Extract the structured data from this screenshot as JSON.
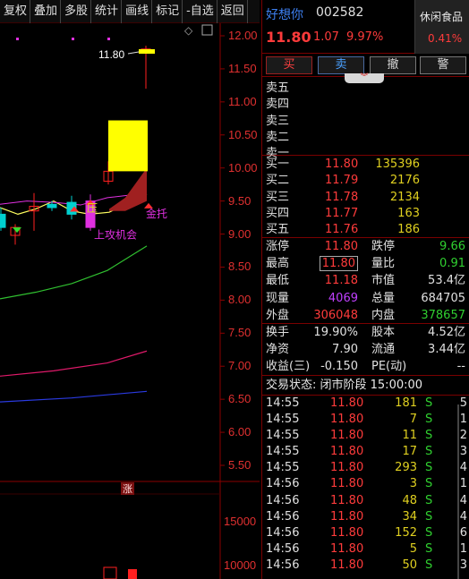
{
  "toolbar": {
    "items": [
      "复权",
      "叠加",
      "多股",
      "统计",
      "画线",
      "标记",
      "-自选",
      "返回"
    ]
  },
  "chart": {
    "price_axis": [
      "12.00",
      "11.50",
      "11.00",
      "10.50",
      "10.00",
      "9.50",
      "9.00",
      "8.50",
      "8.00",
      "7.50",
      "7.00",
      "6.50",
      "6.00",
      "5.50"
    ],
    "volume_axis": [
      "15000",
      "10000"
    ],
    "last_price_label": "11.80",
    "annotations": {
      "pressure": "压",
      "opportunity": "上攻机会",
      "support": "金托",
      "limit_up": "涨"
    },
    "colors": {
      "up": "#ff2020",
      "down": "#00d0d0",
      "limit_block": "#ffff00",
      "ma_fast": "#ffff60",
      "ma_mid": "#30c030",
      "ma_long": "#e01a6a",
      "ma_longest": "#2a3ae0",
      "dot": "#e030e0"
    }
  },
  "stock": {
    "name": "好想你",
    "code": "002582",
    "price": "11.80",
    "change": "1.07",
    "change_pct": "9.97%",
    "sector_name": "休闲食品",
    "sector_pct": "0.41%"
  },
  "trade_buttons": {
    "buy": "买",
    "sell": "卖",
    "cancel": "撤",
    "alert": "警",
    "expand": "︾"
  },
  "sell_book": [
    {
      "label": "卖五",
      "price": "",
      "vol": ""
    },
    {
      "label": "卖四",
      "price": "",
      "vol": ""
    },
    {
      "label": "卖三",
      "price": "",
      "vol": ""
    },
    {
      "label": "卖二",
      "price": "",
      "vol": ""
    },
    {
      "label": "卖一",
      "price": "",
      "vol": ""
    }
  ],
  "buy_book": [
    {
      "label": "买一",
      "price": "11.80",
      "vol": "135396"
    },
    {
      "label": "买二",
      "price": "11.79",
      "vol": "2176"
    },
    {
      "label": "买三",
      "price": "11.78",
      "vol": "2134"
    },
    {
      "label": "买四",
      "price": "11.77",
      "vol": "163"
    },
    {
      "label": "买五",
      "price": "11.76",
      "vol": "186"
    }
  ],
  "stats": [
    {
      "l1": "涨停",
      "v1": "11.80",
      "c1": "#ff3b3b",
      "l2": "跌停",
      "v2": "9.66",
      "c2": "#30d030"
    },
    {
      "l1": "最高",
      "v1": "11.80",
      "c1": "#ff3b3b",
      "l2": "量比",
      "v2": "0.91",
      "c2": "#30d030"
    },
    {
      "l1": "最低",
      "v1": "11.18",
      "c1": "#ff3b3b",
      "l2": "市值",
      "v2": "53.4亿",
      "c2": "#e0e0e0"
    },
    {
      "l1": "现量",
      "v1": "4069",
      "c1": "#c040ff",
      "l2": "总量",
      "v2": "684705",
      "c2": "#e0e0e0"
    },
    {
      "l1": "外盘",
      "v1": "306048",
      "c1": "#ff3b3b",
      "l2": "内盘",
      "v2": "378657",
      "c2": "#30d030"
    }
  ],
  "stats2": [
    {
      "l1": "换手",
      "v1": "19.90%",
      "l2": "股本",
      "v2": "4.52亿"
    },
    {
      "l1": "净资",
      "v1": "7.90",
      "l2": "流通",
      "v2": "3.44亿"
    },
    {
      "l1": "收益(三)",
      "v1": "-0.150",
      "l2": "PE(动)",
      "v2": "--"
    }
  ],
  "phase": {
    "text": "交易状态: 闭市阶段 15:00:00"
  },
  "ticks": [
    {
      "time": "14:55",
      "price": "11.80",
      "vol": "181",
      "dir": "S",
      "n": "5"
    },
    {
      "time": "14:55",
      "price": "11.80",
      "vol": "7",
      "dir": "S",
      "n": "1"
    },
    {
      "time": "14:55",
      "price": "11.80",
      "vol": "11",
      "dir": "S",
      "n": "2"
    },
    {
      "time": "14:55",
      "price": "11.80",
      "vol": "17",
      "dir": "S",
      "n": "3"
    },
    {
      "time": "14:55",
      "price": "11.80",
      "vol": "293",
      "dir": "S",
      "n": "4"
    },
    {
      "time": "14:56",
      "price": "11.80",
      "vol": "3",
      "dir": "S",
      "n": "1"
    },
    {
      "time": "14:56",
      "price": "11.80",
      "vol": "48",
      "dir": "S",
      "n": "4"
    },
    {
      "time": "14:56",
      "price": "11.80",
      "vol": "34",
      "dir": "S",
      "n": "4"
    },
    {
      "time": "14:56",
      "price": "11.80",
      "vol": "152",
      "dir": "S",
      "n": "6"
    },
    {
      "time": "14:56",
      "price": "11.80",
      "vol": "5",
      "dir": "S",
      "n": "1"
    },
    {
      "time": "14:56",
      "price": "11.80",
      "vol": "50",
      "dir": "S",
      "n": "3"
    }
  ]
}
